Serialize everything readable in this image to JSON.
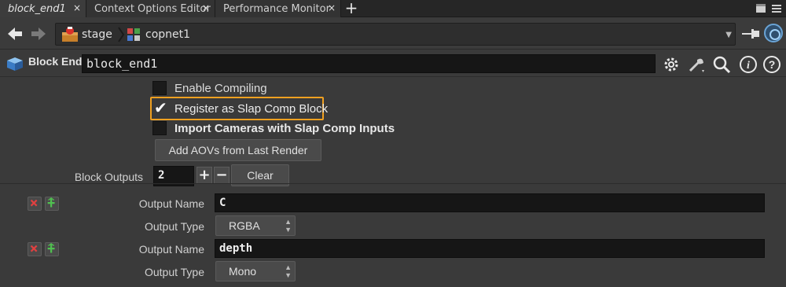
{
  "tabs": [
    {
      "label": "block_end1",
      "active": true
    },
    {
      "label": "Context Options Editor",
      "active": false
    },
    {
      "label": "Performance Monitor",
      "active": false
    }
  ],
  "tab_close_glyph": "×",
  "tab_add_glyph": "+",
  "path": {
    "crumbs": [
      "stage",
      "copnet1"
    ]
  },
  "node": {
    "type_label": "Block End",
    "name": "block_end1"
  },
  "params": {
    "enable_compiling": {
      "label": "Enable Compiling",
      "checked": false
    },
    "register_slap_comp": {
      "label": "Register as Slap Comp Block",
      "checked": true
    },
    "import_cameras": {
      "label": "Import Cameras with Slap Comp Inputs",
      "checked": false
    },
    "add_aovs_button": "Add AOVs from Last Render",
    "block_outputs": {
      "label": "Block Outputs",
      "value": "2",
      "plus": "+",
      "minus": "−",
      "clear": "Clear"
    },
    "outputs": [
      {
        "name_label": "Output Name",
        "name_value": "C",
        "type_label": "Output Type",
        "type_value": "RGBA"
      },
      {
        "name_label": "Output Name",
        "name_value": "depth",
        "type_label": "Output Type",
        "type_value": "Mono"
      }
    ]
  },
  "colors": {
    "highlight": "#f0a020",
    "accent_blue": "#6aa4d6"
  },
  "icons": [
    "back-arrow-icon",
    "forward-arrow-icon",
    "stage-icon",
    "copnet-icon",
    "pin-icon",
    "link-icon",
    "node-icon",
    "gear-icon",
    "wrench-icon",
    "search-icon",
    "info-icon",
    "help-icon",
    "remove-icon",
    "insert-icon"
  ]
}
